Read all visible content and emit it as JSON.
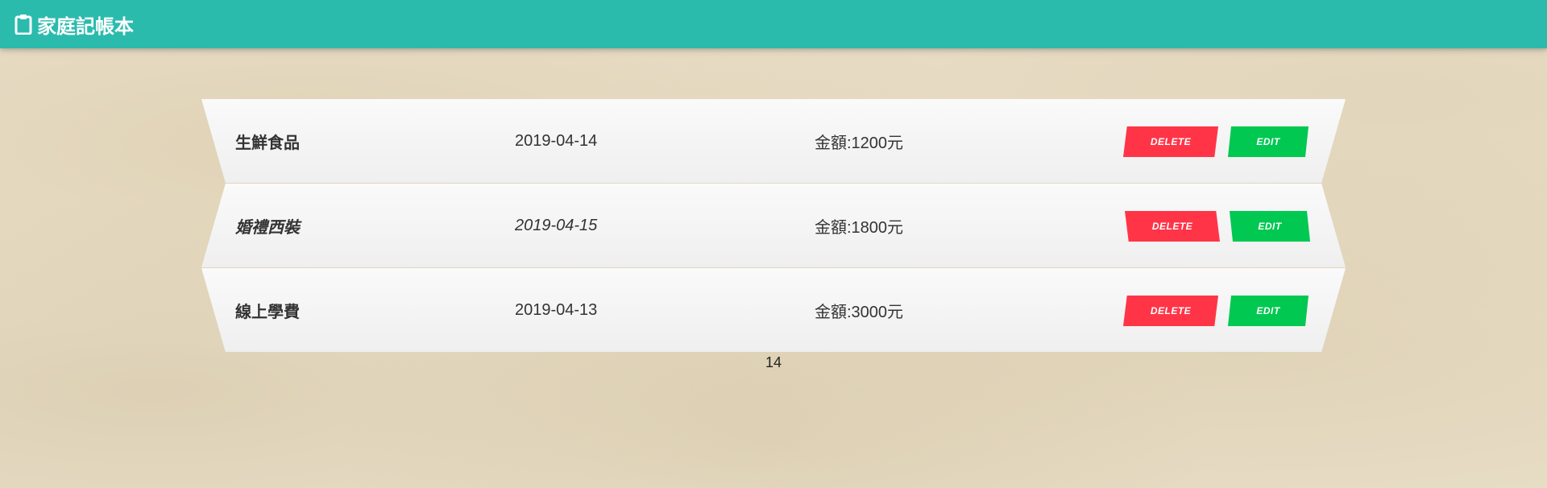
{
  "navbar": {
    "brand_icon": "clipboard-icon",
    "brand_title": "家庭記帳本",
    "bg_color": "#2bbbad"
  },
  "records": [
    {
      "name": "生鮮食品",
      "date": "2019-04-14",
      "amount": "金額:1200元",
      "delete_label": "DELETE",
      "edit_label": "EDIT"
    },
    {
      "name": "婚禮西裝",
      "date": "2019-04-15",
      "amount": "金額:1800元",
      "delete_label": "DELETE",
      "edit_label": "EDIT"
    },
    {
      "name": "線上學費",
      "date": "2019-04-13",
      "amount": "金額:3000元",
      "delete_label": "DELETE",
      "edit_label": "EDIT"
    }
  ],
  "colors": {
    "delete": "#ff3547",
    "edit": "#00c851"
  },
  "footer": {
    "page_number": "14"
  }
}
